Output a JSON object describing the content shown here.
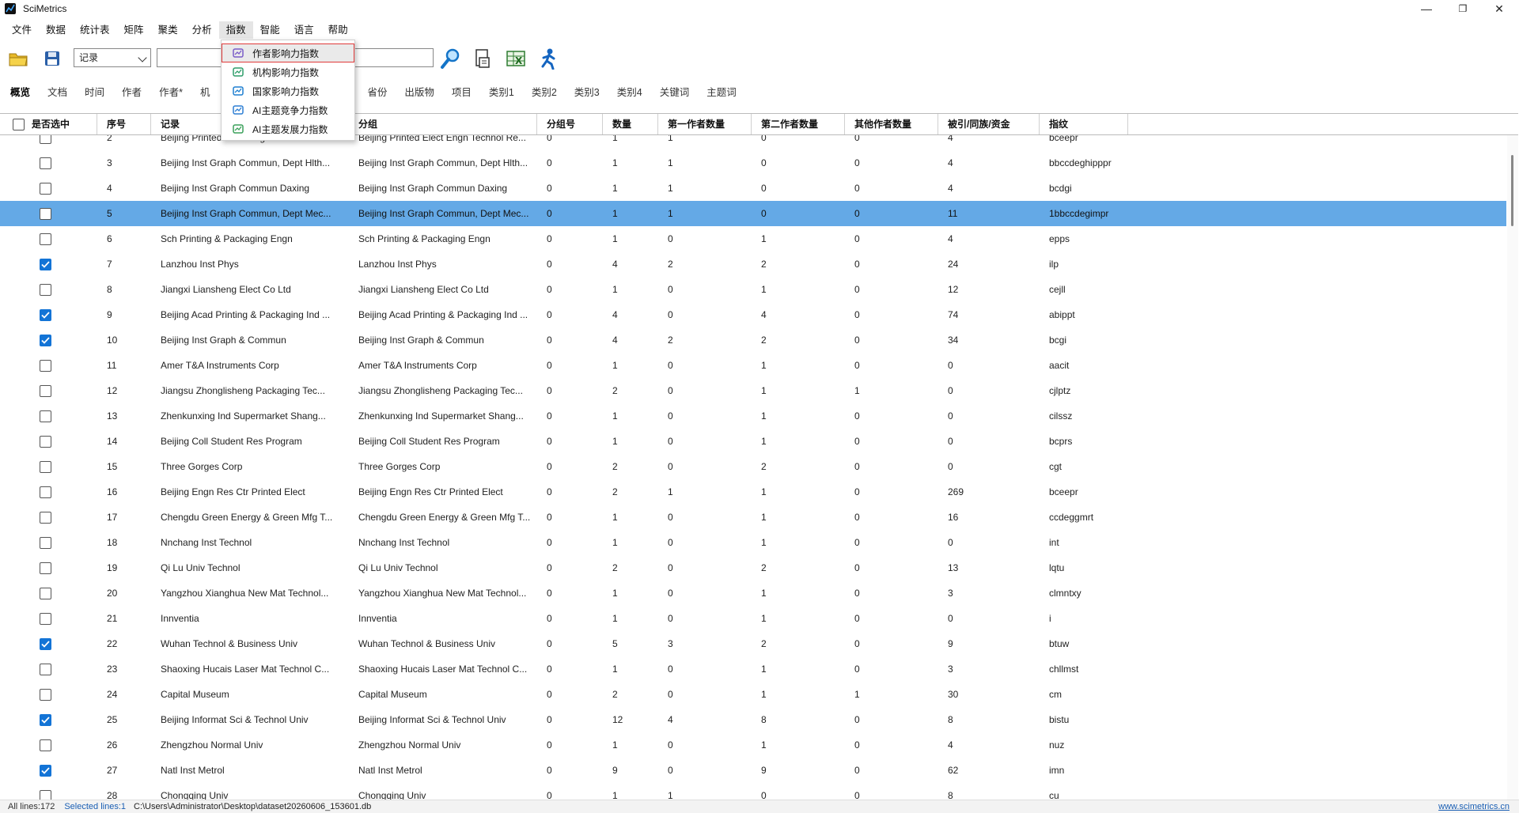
{
  "window": {
    "title": "SciMetrics",
    "min": "—",
    "max": "❐",
    "close": "✕"
  },
  "menu": [
    "文件",
    "数据",
    "统计表",
    "矩阵",
    "聚类",
    "分析",
    "指数",
    "智能",
    "语言",
    "帮助"
  ],
  "active_menu_index": 6,
  "toolbar": {
    "combo_value": "记录",
    "search_value": ""
  },
  "tabs": [
    "概览",
    "文档",
    "时间",
    "作者",
    "作者*",
    "机",
    "省份",
    "出版物",
    "项目",
    "类别1",
    "类别2",
    "类别3",
    "类别4",
    "关键词",
    "主题词"
  ],
  "hidden_tab_fragment": "*",
  "dropdown": {
    "items": [
      "作者影响力指数",
      "机构影响力指数",
      "国家影响力指数",
      "AI主题竞争力指数",
      "AI主题发展力指数"
    ],
    "highlight_index": 0
  },
  "grid": {
    "columns": [
      "是否选中",
      "序号",
      "记录",
      "分组",
      "分组号",
      "数量",
      "第一作者数量",
      "第二作者数量",
      "其他作者数量",
      "被引/同族/资金",
      "指纹"
    ],
    "selected_row_index": 3,
    "rows": [
      {
        "checked": false,
        "no": "2",
        "record": "Beijing Printed Elect Engn Technol Re...",
        "group": "Beijing Printed Elect Engn Technol Re...",
        "gno": "0",
        "count": "1",
        "first": "1",
        "second": "0",
        "other": "0",
        "cited": "4",
        "fp": "bceepr"
      },
      {
        "checked": false,
        "no": "3",
        "record": "Beijing Inst Graph Commun, Dept Hlth...",
        "group": "Beijing Inst Graph Commun, Dept Hlth...",
        "gno": "0",
        "count": "1",
        "first": "1",
        "second": "0",
        "other": "0",
        "cited": "4",
        "fp": "bbccdeghipppr"
      },
      {
        "checked": false,
        "no": "4",
        "record": "Beijing Inst Graph Commun Daxing",
        "group": "Beijing Inst Graph Commun Daxing",
        "gno": "0",
        "count": "1",
        "first": "1",
        "second": "0",
        "other": "0",
        "cited": "4",
        "fp": "bcdgi"
      },
      {
        "checked": false,
        "no": "5",
        "record": "Beijing Inst Graph Commun, Dept Mec...",
        "group": "Beijing Inst Graph Commun, Dept Mec...",
        "gno": "0",
        "count": "1",
        "first": "1",
        "second": "0",
        "other": "0",
        "cited": "11",
        "fp": "1bbccdegimpr"
      },
      {
        "checked": false,
        "no": "6",
        "record": "Sch Printing & Packaging Engn",
        "group": "Sch Printing & Packaging Engn",
        "gno": "0",
        "count": "1",
        "first": "0",
        "second": "1",
        "other": "0",
        "cited": "4",
        "fp": "epps"
      },
      {
        "checked": true,
        "no": "7",
        "record": "Lanzhou Inst Phys",
        "group": "Lanzhou Inst Phys",
        "gno": "0",
        "count": "4",
        "first": "2",
        "second": "2",
        "other": "0",
        "cited": "24",
        "fp": "ilp"
      },
      {
        "checked": false,
        "no": "8",
        "record": "Jiangxi Liansheng Elect Co Ltd",
        "group": "Jiangxi Liansheng Elect Co Ltd",
        "gno": "0",
        "count": "1",
        "first": "0",
        "second": "1",
        "other": "0",
        "cited": "12",
        "fp": "cejll"
      },
      {
        "checked": true,
        "no": "9",
        "record": "Beijing Acad Printing & Packaging Ind ...",
        "group": "Beijing Acad Printing & Packaging Ind ...",
        "gno": "0",
        "count": "4",
        "first": "0",
        "second": "4",
        "other": "0",
        "cited": "74",
        "fp": "abippt"
      },
      {
        "checked": true,
        "no": "10",
        "record": "Beijing Inst Graph & Commun",
        "group": "Beijing Inst Graph & Commun",
        "gno": "0",
        "count": "4",
        "first": "2",
        "second": "2",
        "other": "0",
        "cited": "34",
        "fp": "bcgi"
      },
      {
        "checked": false,
        "no": "11",
        "record": "Amer T&A Instruments Corp",
        "group": "Amer T&A Instruments Corp",
        "gno": "0",
        "count": "1",
        "first": "0",
        "second": "1",
        "other": "0",
        "cited": "0",
        "fp": "aacit"
      },
      {
        "checked": false,
        "no": "12",
        "record": "Jiangsu Zhonglisheng Packaging Tec...",
        "group": "Jiangsu Zhonglisheng Packaging Tec...",
        "gno": "0",
        "count": "2",
        "first": "0",
        "second": "1",
        "other": "1",
        "cited": "0",
        "fp": "cjlptz"
      },
      {
        "checked": false,
        "no": "13",
        "record": "Zhenkunxing Ind Supermarket Shang...",
        "group": "Zhenkunxing Ind Supermarket Shang...",
        "gno": "0",
        "count": "1",
        "first": "0",
        "second": "1",
        "other": "0",
        "cited": "0",
        "fp": "cilssz"
      },
      {
        "checked": false,
        "no": "14",
        "record": "Beijing Coll Student Res Program",
        "group": "Beijing Coll Student Res Program",
        "gno": "0",
        "count": "1",
        "first": "0",
        "second": "1",
        "other": "0",
        "cited": "0",
        "fp": "bcprs"
      },
      {
        "checked": false,
        "no": "15",
        "record": "Three Gorges Corp",
        "group": "Three Gorges Corp",
        "gno": "0",
        "count": "2",
        "first": "0",
        "second": "2",
        "other": "0",
        "cited": "0",
        "fp": "cgt"
      },
      {
        "checked": false,
        "no": "16",
        "record": "Beijing Engn Res Ctr Printed Elect",
        "group": "Beijing Engn Res Ctr Printed Elect",
        "gno": "0",
        "count": "2",
        "first": "1",
        "second": "1",
        "other": "0",
        "cited": "269",
        "fp": "bceepr"
      },
      {
        "checked": false,
        "no": "17",
        "record": "Chengdu Green Energy & Green Mfg T...",
        "group": "Chengdu Green Energy & Green Mfg T...",
        "gno": "0",
        "count": "1",
        "first": "0",
        "second": "1",
        "other": "0",
        "cited": "16",
        "fp": "ccdeggmrt"
      },
      {
        "checked": false,
        "no": "18",
        "record": "Nnchang Inst Technol",
        "group": "Nnchang Inst Technol",
        "gno": "0",
        "count": "1",
        "first": "0",
        "second": "1",
        "other": "0",
        "cited": "0",
        "fp": "int"
      },
      {
        "checked": false,
        "no": "19",
        "record": "Qi Lu Univ Technol",
        "group": "Qi Lu Univ Technol",
        "gno": "0",
        "count": "2",
        "first": "0",
        "second": "2",
        "other": "0",
        "cited": "13",
        "fp": "lqtu"
      },
      {
        "checked": false,
        "no": "20",
        "record": "Yangzhou Xianghua New Mat Technol...",
        "group": "Yangzhou Xianghua New Mat Technol...",
        "gno": "0",
        "count": "1",
        "first": "0",
        "second": "1",
        "other": "0",
        "cited": "3",
        "fp": "clmntxy"
      },
      {
        "checked": false,
        "no": "21",
        "record": "Innventia",
        "group": "Innventia",
        "gno": "0",
        "count": "1",
        "first": "0",
        "second": "1",
        "other": "0",
        "cited": "0",
        "fp": "i"
      },
      {
        "checked": true,
        "no": "22",
        "record": "Wuhan Technol & Business Univ",
        "group": "Wuhan Technol & Business Univ",
        "gno": "0",
        "count": "5",
        "first": "3",
        "second": "2",
        "other": "0",
        "cited": "9",
        "fp": "btuw"
      },
      {
        "checked": false,
        "no": "23",
        "record": "Shaoxing Hucais Laser Mat Technol C...",
        "group": "Shaoxing Hucais Laser Mat Technol C...",
        "gno": "0",
        "count": "1",
        "first": "0",
        "second": "1",
        "other": "0",
        "cited": "3",
        "fp": "chllmst"
      },
      {
        "checked": false,
        "no": "24",
        "record": "Capital Museum",
        "group": "Capital Museum",
        "gno": "0",
        "count": "2",
        "first": "0",
        "second": "1",
        "other": "1",
        "cited": "30",
        "fp": "cm"
      },
      {
        "checked": true,
        "no": "25",
        "record": "Beijing Informat Sci & Technol Univ",
        "group": "Beijing Informat Sci & Technol Univ",
        "gno": "0",
        "count": "12",
        "first": "4",
        "second": "8",
        "other": "0",
        "cited": "8",
        "fp": "bistu"
      },
      {
        "checked": false,
        "no": "26",
        "record": "Zhengzhou Normal Univ",
        "group": "Zhengzhou Normal Univ",
        "gno": "0",
        "count": "1",
        "first": "0",
        "second": "1",
        "other": "0",
        "cited": "4",
        "fp": "nuz"
      },
      {
        "checked": true,
        "no": "27",
        "record": "Natl Inst Metrol",
        "group": "Natl Inst Metrol",
        "gno": "0",
        "count": "9",
        "first": "0",
        "second": "9",
        "other": "0",
        "cited": "62",
        "fp": "imn"
      },
      {
        "checked": false,
        "no": "28",
        "record": "Chongqing Univ",
        "group": "Chongqing Univ",
        "gno": "0",
        "count": "1",
        "first": "1",
        "second": "0",
        "other": "0",
        "cited": "8",
        "fp": "cu"
      }
    ]
  },
  "status": {
    "all": "All lines:172",
    "selected": "Selected lines:1",
    "path": "C:\\Users\\Administrator\\Desktop\\dataset20260606_153601.db",
    "link": "www.scimetrics.cn"
  }
}
